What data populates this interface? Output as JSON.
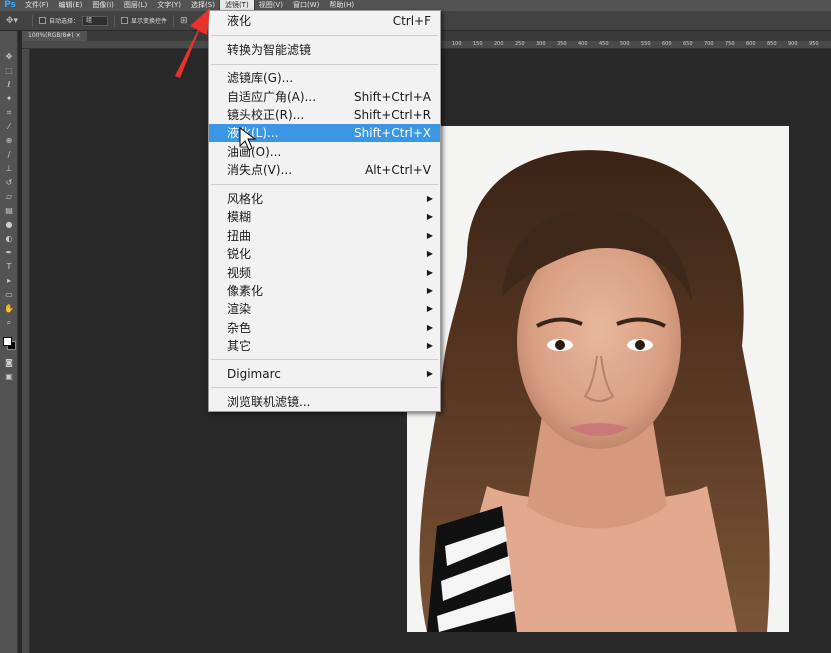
{
  "app": {
    "logo": "Ps"
  },
  "menubar": {
    "items": [
      {
        "label": "文件(F)"
      },
      {
        "label": "编辑(E)"
      },
      {
        "label": "图像(I)"
      },
      {
        "label": "图层(L)"
      },
      {
        "label": "文字(Y)"
      },
      {
        "label": "选择(S)"
      },
      {
        "label": "滤镜(T)",
        "active": true
      },
      {
        "label": "视图(V)"
      },
      {
        "label": "窗口(W)"
      },
      {
        "label": "帮助(H)"
      }
    ]
  },
  "options_bar": {
    "auto_select_label": "自动选择：",
    "auto_select_value": "组",
    "show_transform_label": "显示变换控件"
  },
  "document": {
    "tab_label": "100%(RGB/8#)"
  },
  "ruler_labels": [
    "100",
    "150",
    "200",
    "250",
    "300",
    "350",
    "400",
    "450",
    "500",
    "550",
    "600",
    "650",
    "700",
    "750",
    "800",
    "850",
    "900",
    "950",
    "1000"
  ],
  "filter_menu": {
    "items": [
      {
        "label": "液化",
        "shortcut": "Ctrl+F"
      },
      {
        "label": "转换为智能滤镜"
      },
      {
        "label": "滤镜库(G)..."
      },
      {
        "label": "自适应广角(A)...",
        "shortcut": "Shift+Ctrl+A"
      },
      {
        "label": "镜头校正(R)...",
        "shortcut": "Shift+Ctrl+R"
      },
      {
        "label": "液化(L)...",
        "shortcut": "Shift+Ctrl+X",
        "highlighted": true
      },
      {
        "label": "油画(O)..."
      },
      {
        "label": "消失点(V)...",
        "shortcut": "Alt+Ctrl+V"
      },
      {
        "label": "风格化",
        "submenu": true
      },
      {
        "label": "模糊",
        "submenu": true
      },
      {
        "label": "扭曲",
        "submenu": true
      },
      {
        "label": "锐化",
        "submenu": true
      },
      {
        "label": "视频",
        "submenu": true
      },
      {
        "label": "像素化",
        "submenu": true
      },
      {
        "label": "渲染",
        "submenu": true
      },
      {
        "label": "杂色",
        "submenu": true
      },
      {
        "label": "其它",
        "submenu": true
      },
      {
        "label": "Digimarc",
        "submenu": true
      },
      {
        "label": "浏览联机滤镜..."
      }
    ]
  },
  "colors": {
    "accent": "#3b97e3",
    "annotation_arrow": "#e8322c",
    "foreground_swatch": "#ffffff",
    "background_swatch": "#000000"
  },
  "icons": [
    "move-tool-icon",
    "marquee-tool-icon",
    "lasso-tool-icon",
    "magic-wand-icon",
    "crop-tool-icon",
    "eyedropper-icon",
    "healing-brush-icon",
    "brush-tool-icon",
    "clone-stamp-icon",
    "history-brush-icon",
    "eraser-icon",
    "gradient-tool-icon",
    "blur-tool-icon",
    "dodge-tool-icon",
    "pen-tool-icon",
    "type-tool-icon",
    "path-selection-icon",
    "rectangle-tool-icon",
    "hand-tool-icon",
    "zoom-tool-icon",
    "submenu-arrow-icon",
    "mouse-cursor-icon",
    "red-annotation-arrow-icon"
  ]
}
